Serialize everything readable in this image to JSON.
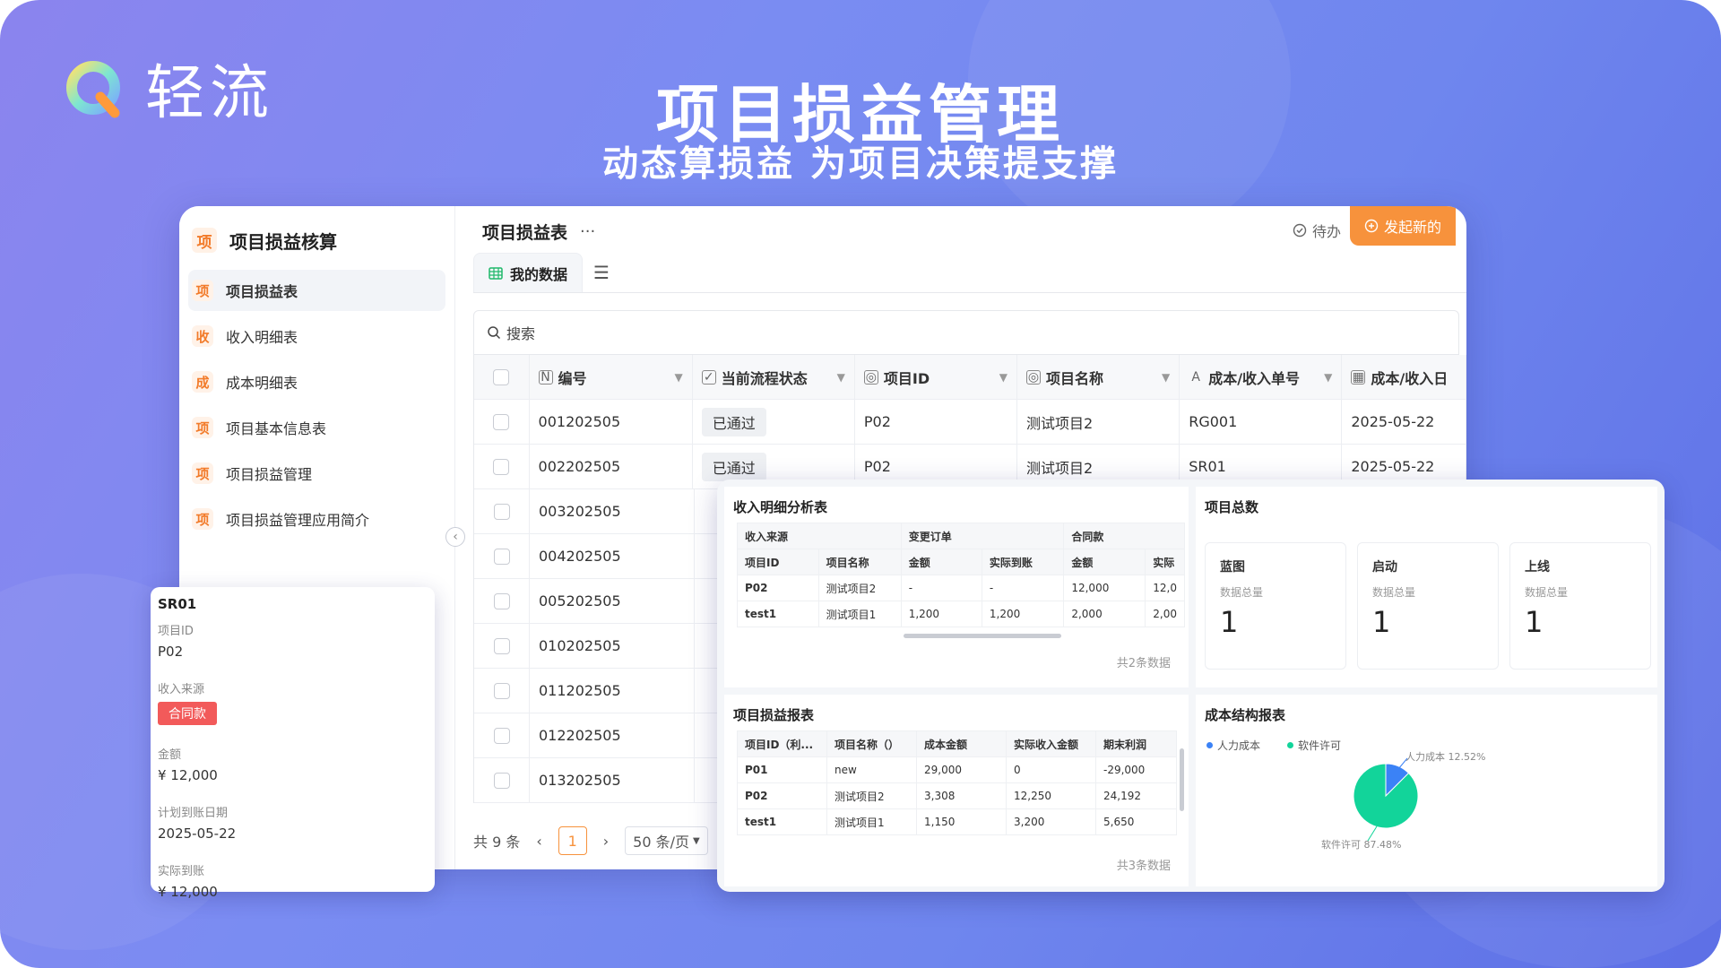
{
  "brand": {
    "name": "轻流"
  },
  "hero": {
    "title": "项目损益管理",
    "subtitle": "动态算损益 为项目决策提支撑"
  },
  "sidebar": {
    "app_icon": "项",
    "app_title": "项目损益核算",
    "items": [
      {
        "icon": "项",
        "label": "项目损益表"
      },
      {
        "icon": "收",
        "label": "收入明细表"
      },
      {
        "icon": "成",
        "label": "成本明细表"
      },
      {
        "icon": "项",
        "label": "项目基本信息表"
      },
      {
        "icon": "项",
        "label": "项目损益管理"
      },
      {
        "icon": "项",
        "label": "项目损益管理应用简介"
      }
    ]
  },
  "topbar": {
    "title": "项目损益表",
    "more": "···",
    "todo": "待办",
    "launch": "发起新的"
  },
  "tabs": {
    "my_data": "我的数据"
  },
  "search": {
    "placeholder": "搜索"
  },
  "table": {
    "columns": [
      "编号",
      "当前流程状态",
      "项目ID",
      "项目名称",
      "成本/收入单号",
      "成本/收入日"
    ],
    "rows": [
      [
        "001202505",
        "已通过",
        "P02",
        "测试项目2",
        "RG001",
        "2025-05-22"
      ],
      [
        "002202505",
        "已通过",
        "P02",
        "测试项目2",
        "SR01",
        "2025-05-22"
      ],
      [
        "003202505",
        "",
        "",
        "",
        "",
        ""
      ],
      [
        "004202505",
        "",
        "",
        "",
        "",
        ""
      ],
      [
        "005202505",
        "",
        "",
        "",
        "",
        ""
      ],
      [
        "010202505",
        "",
        "",
        "",
        "",
        ""
      ],
      [
        "011202505",
        "",
        "",
        "",
        "",
        ""
      ],
      [
        "012202505",
        "",
        "",
        "",
        "",
        ""
      ],
      [
        "013202505",
        "",
        "",
        "",
        "",
        ""
      ]
    ]
  },
  "pager": {
    "total": "共 9 条",
    "page": "1",
    "size": "50 条/页"
  },
  "detail_card": {
    "title": "SR01",
    "f1_label": "项目ID",
    "f1_value": "P02",
    "f2_label": "收入来源",
    "f2_value": "合同款",
    "f3_label": "金额",
    "f3_value": "¥ 12,000",
    "f4_label": "计划到账日期",
    "f4_value": "2025-05-22",
    "f5_label": "实际到账",
    "f5_value": "¥ 12,000"
  },
  "income_panel": {
    "title": "收入明细分析表",
    "group_row": [
      "收入来源",
      "变更订单",
      "合同款"
    ],
    "header": [
      "项目ID",
      "项目名称",
      "金额",
      "实际到账",
      "金额",
      "实际"
    ],
    "rows": [
      [
        "P02",
        "测试项目2",
        "-",
        "-",
        "12,000",
        "12,0"
      ],
      [
        "test1",
        "测试项目1",
        "1,200",
        "1,200",
        "2,000",
        "2,00"
      ]
    ],
    "footer": "共2条数据"
  },
  "count_panel": {
    "title": "项目总数",
    "kpis": [
      {
        "name": "蓝图",
        "sub": "数据总量",
        "value": "1"
      },
      {
        "name": "启动",
        "sub": "数据总量",
        "value": "1"
      },
      {
        "name": "上线",
        "sub": "数据总量",
        "value": "1"
      }
    ]
  },
  "pl_panel": {
    "title": "项目损益报表",
    "header": [
      "项目ID（利...",
      "项目名称（）",
      "成本金额",
      "实际收入金额",
      "期末利润"
    ],
    "rows": [
      [
        "P01",
        "new",
        "29,000",
        "0",
        "-29,000"
      ],
      [
        "P02",
        "测试项目2",
        "3,308",
        "12,250",
        "24,192"
      ],
      [
        "test1",
        "测试项目1",
        "1,150",
        "3,200",
        "5,650"
      ]
    ],
    "footer": "共3条数据"
  },
  "chart_data": {
    "type": "pie",
    "title": "成本结构报表",
    "categories": [
      "人力成本",
      "软件许可"
    ],
    "values": [
      12.52,
      87.48
    ],
    "labels": [
      "人力成本 12.52%",
      "软件许可 87.48%"
    ],
    "colors": [
      "#3b82f6",
      "#12d49a"
    ],
    "legend": "top-left"
  }
}
